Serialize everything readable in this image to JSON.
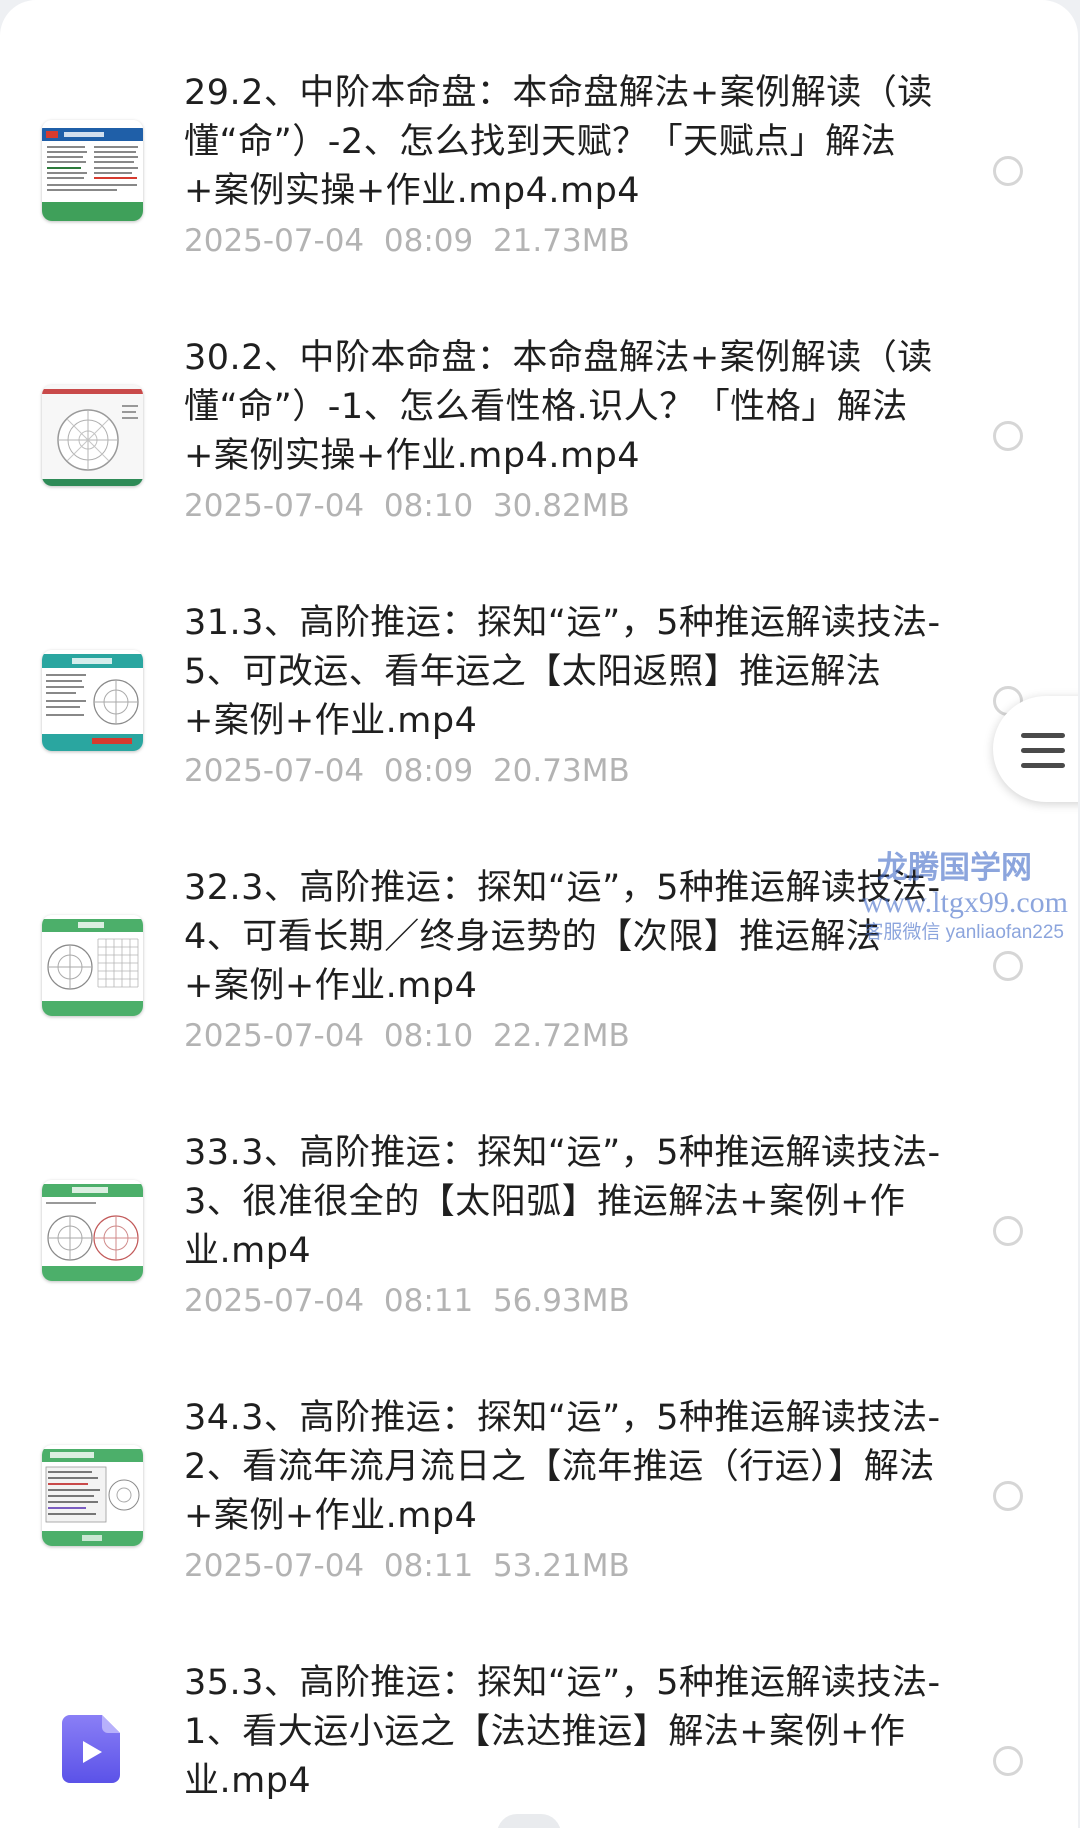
{
  "files": [
    {
      "name": "29.2、中阶本命盘：本命盘解法+案例解读（读懂“命”）-2、怎么找到天赋？「天赋点」解法+案例实操+作业.mp4.mp4",
      "date": "2025-07-04",
      "time": "08:09",
      "size": "21.73MB",
      "thumbnail": "blue-slide-with-text",
      "selected": false
    },
    {
      "name": "30.2、中阶本命盘：本命盘解法+案例解读（读懂“命”）-1、怎么看性格.识人？「性格」解法+案例实操+作业.mp4.mp4",
      "date": "2025-07-04",
      "time": "08:10",
      "size": "30.82MB",
      "thumbnail": "white-slide-with-chart-wheel",
      "selected": false
    },
    {
      "name": "31.3、高阶推运：探知“运”，5种推运解读技法-5、可改运、看年运之【太阳返照】推运解法+案例+作业.mp4",
      "date": "2025-07-04",
      "time": "08:09",
      "size": "20.73MB",
      "thumbnail": "teal-slide-with-chart",
      "selected": false
    },
    {
      "name": "32.3、高阶推运：探知“运”，5种推运解读技法-4、可看长期／终身运势的【次限】推运解法+案例+作业.mp4",
      "date": "2025-07-04",
      "time": "08:10",
      "size": "22.72MB",
      "thumbnail": "green-slide-with-grid",
      "selected": false
    },
    {
      "name": "33.3、高阶推运：探知“运”，5种推运解读技法-3、很准很全的【太阳弧】推运解法+案例+作业.mp4",
      "date": "2025-07-04",
      "time": "08:11",
      "size": "56.93MB",
      "thumbnail": "green-slide-with-two-wheels",
      "selected": false
    },
    {
      "name": "34.3、高阶推运：探知“运”，5种推运解读技法-2、看流年流月流日之【流年推运（行运）】解法+案例+作业.mp4",
      "date": "2025-07-04",
      "time": "08:11",
      "size": "53.21MB",
      "thumbnail": "green-slide-with-table",
      "selected": false
    },
    {
      "name": "35.3、高阶推运：探知“运”，5种推运解读技法-1、看大运小运之【法达推运】解法+案例+作业.mp4",
      "date": "",
      "time": "",
      "size": "",
      "thumbnail": "video-file-icon",
      "selected": false
    }
  ],
  "watermark": {
    "title": "龙腾国学网",
    "url": "www.ltgx99.com",
    "contact": "客服微信 yanliaofan225"
  },
  "side_menu": {
    "icon": "hamburger-menu-icon"
  },
  "colors": {
    "text_primary": "#1f1f1f",
    "text_secondary": "#b3b3b3",
    "radio_border": "#d6d6d6",
    "video_icon": "#6b63f0",
    "watermark": "#466ec8"
  }
}
